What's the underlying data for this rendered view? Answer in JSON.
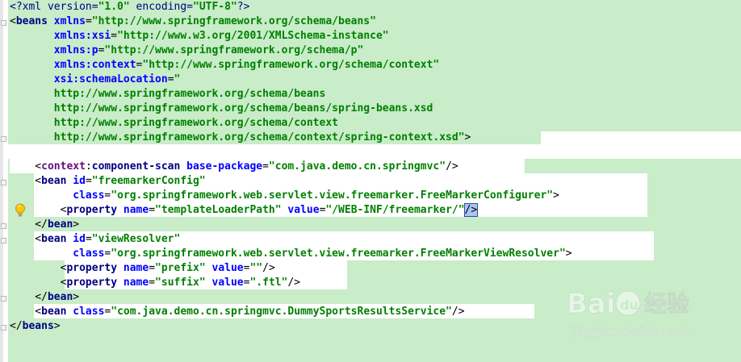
{
  "editor": {
    "lines": [
      [
        [
          "tk-pi",
          "<?xml version="
        ],
        [
          "tk-str",
          "\"1.0\""
        ],
        [
          "tk-pi",
          " encoding="
        ],
        [
          "tk-str",
          "\"UTF-8\""
        ],
        [
          "tk-pi",
          "?>"
        ]
      ],
      [
        [
          "tk-punct",
          "<"
        ],
        [
          "tk-tag",
          "beans "
        ],
        [
          "tk-attr",
          "xmlns"
        ],
        [
          "tk-punct",
          "="
        ],
        [
          "tk-str",
          "\"http://www.springframework.org/schema/beans\""
        ]
      ],
      [
        [
          "tk-punct",
          "       "
        ],
        [
          "tk-attr",
          "xmlns:xsi"
        ],
        [
          "tk-punct",
          "="
        ],
        [
          "tk-str",
          "\"http://www.w3.org/2001/XMLSchema-instance\""
        ]
      ],
      [
        [
          "tk-punct",
          "       "
        ],
        [
          "tk-attr",
          "xmlns:p"
        ],
        [
          "tk-punct",
          "="
        ],
        [
          "tk-str",
          "\"http://www.springframework.org/schema/p\""
        ]
      ],
      [
        [
          "tk-punct",
          "       "
        ],
        [
          "tk-attr",
          "xmlns:context"
        ],
        [
          "tk-punct",
          "="
        ],
        [
          "tk-str",
          "\"http://www.springframework.org/schema/context\""
        ]
      ],
      [
        [
          "tk-punct",
          "       "
        ],
        [
          "tk-attr",
          "xsi:schemaLocation"
        ],
        [
          "tk-punct",
          "="
        ],
        [
          "tk-str",
          "\""
        ]
      ],
      [
        [
          "tk-str",
          "       http://www.springframework.org/schema/beans"
        ]
      ],
      [
        [
          "tk-str",
          "       http://www.springframework.org/schema/beans/spring-beans.xsd"
        ]
      ],
      [
        [
          "tk-str",
          "       http://www.springframework.org/schema/context"
        ]
      ],
      [
        [
          "tk-str",
          "       http://www.springframework.org/schema/context/spring-context.xsd\""
        ],
        [
          "tk-punct",
          ">"
        ]
      ],
      [],
      [
        [
          "tk-punct",
          "    <"
        ],
        [
          "tk-ns",
          "context"
        ],
        [
          "tk-punct",
          ":"
        ],
        [
          "tk-tag",
          "component-scan "
        ],
        [
          "tk-attr",
          "base-package"
        ],
        [
          "tk-punct",
          "="
        ],
        [
          "tk-str",
          "\"com.java.demo.cn.springmvc\""
        ],
        [
          "tk-punct",
          "/>"
        ]
      ],
      [
        [
          "tk-punct",
          "    <"
        ],
        [
          "tk-tag",
          "bean "
        ],
        [
          "tk-attr",
          "id"
        ],
        [
          "tk-punct",
          "="
        ],
        [
          "tk-str",
          "\"freemarkerConfig\""
        ]
      ],
      [
        [
          "tk-punct",
          "          "
        ],
        [
          "tk-attr",
          "class"
        ],
        [
          "tk-punct",
          "="
        ],
        [
          "tk-str",
          "\"org.springframework.web.servlet.view.freemarker.FreeMarkerConfigurer\""
        ],
        [
          "tk-punct",
          ">"
        ]
      ],
      [
        [
          "tk-punct",
          "        <"
        ],
        [
          "tk-tag",
          "property "
        ],
        [
          "tk-attr",
          "name"
        ],
        [
          "tk-punct",
          "="
        ],
        [
          "tk-str",
          "\"templateLoaderPath\""
        ],
        [
          "tk-punct",
          " "
        ],
        [
          "tk-attr",
          "value"
        ],
        [
          "tk-punct",
          "="
        ],
        [
          "tk-str",
          "\"/WEB-INF/freemarker/\""
        ],
        [
          "caret",
          "/>"
        ]
      ],
      [
        [
          "tk-punct",
          "    </"
        ],
        [
          "tk-tag",
          "bean"
        ],
        [
          "tk-punct",
          ">"
        ]
      ],
      [
        [
          "tk-punct",
          "    <"
        ],
        [
          "tk-tag",
          "bean "
        ],
        [
          "tk-attr",
          "id"
        ],
        [
          "tk-punct",
          "="
        ],
        [
          "tk-str",
          "\"viewResolver\""
        ]
      ],
      [
        [
          "tk-punct",
          "          "
        ],
        [
          "tk-attr",
          "class"
        ],
        [
          "tk-punct",
          "="
        ],
        [
          "tk-str",
          "\"org.springframework.web.servlet.view.freemarker.FreeMarkerViewResolver\""
        ],
        [
          "tk-punct",
          ">"
        ]
      ],
      [
        [
          "tk-punct",
          "        <"
        ],
        [
          "tk-tag",
          "property "
        ],
        [
          "tk-attr",
          "name"
        ],
        [
          "tk-punct",
          "="
        ],
        [
          "tk-str",
          "\"prefix\""
        ],
        [
          "tk-punct",
          " "
        ],
        [
          "tk-attr",
          "value"
        ],
        [
          "tk-punct",
          "="
        ],
        [
          "tk-str",
          "\"\""
        ],
        [
          "tk-punct",
          "/>"
        ]
      ],
      [
        [
          "tk-punct",
          "        <"
        ],
        [
          "tk-tag",
          "property "
        ],
        [
          "tk-attr",
          "name"
        ],
        [
          "tk-punct",
          "="
        ],
        [
          "tk-str",
          "\"suffix\""
        ],
        [
          "tk-punct",
          " "
        ],
        [
          "tk-attr",
          "value"
        ],
        [
          "tk-punct",
          "="
        ],
        [
          "tk-str",
          "\".ftl\""
        ],
        [
          "tk-punct",
          "/>"
        ]
      ],
      [
        [
          "tk-punct",
          "    </"
        ],
        [
          "tk-tag",
          "bean"
        ],
        [
          "tk-punct",
          ">"
        ]
      ],
      [
        [
          "tk-punct",
          "    <"
        ],
        [
          "tk-tag",
          "bean "
        ],
        [
          "tk-attr",
          "class"
        ],
        [
          "tk-punct",
          "="
        ],
        [
          "tk-str",
          "\"com.java.demo.cn.springmvc.DummySportsResultsService\""
        ],
        [
          "tk-punct",
          "/>"
        ]
      ],
      [
        [
          "tk-punct",
          "</"
        ],
        [
          "tk-tag",
          "beans"
        ],
        [
          "tk-punct",
          ">"
        ]
      ]
    ],
    "colors": {
      "highlight": "#c9ecc9",
      "tag": "#000080",
      "attribute": "#0000ff",
      "string": "#008000",
      "namespace": "#660e7a",
      "caret_selection": "#a9c4f3"
    },
    "icons": [
      "lightbulb-icon",
      "fold-marker-icon"
    ]
  },
  "watermark": {
    "brand": "Bai",
    "brand_paw": "du",
    "service": "经验",
    "url": "jingyan.baidu.com"
  }
}
